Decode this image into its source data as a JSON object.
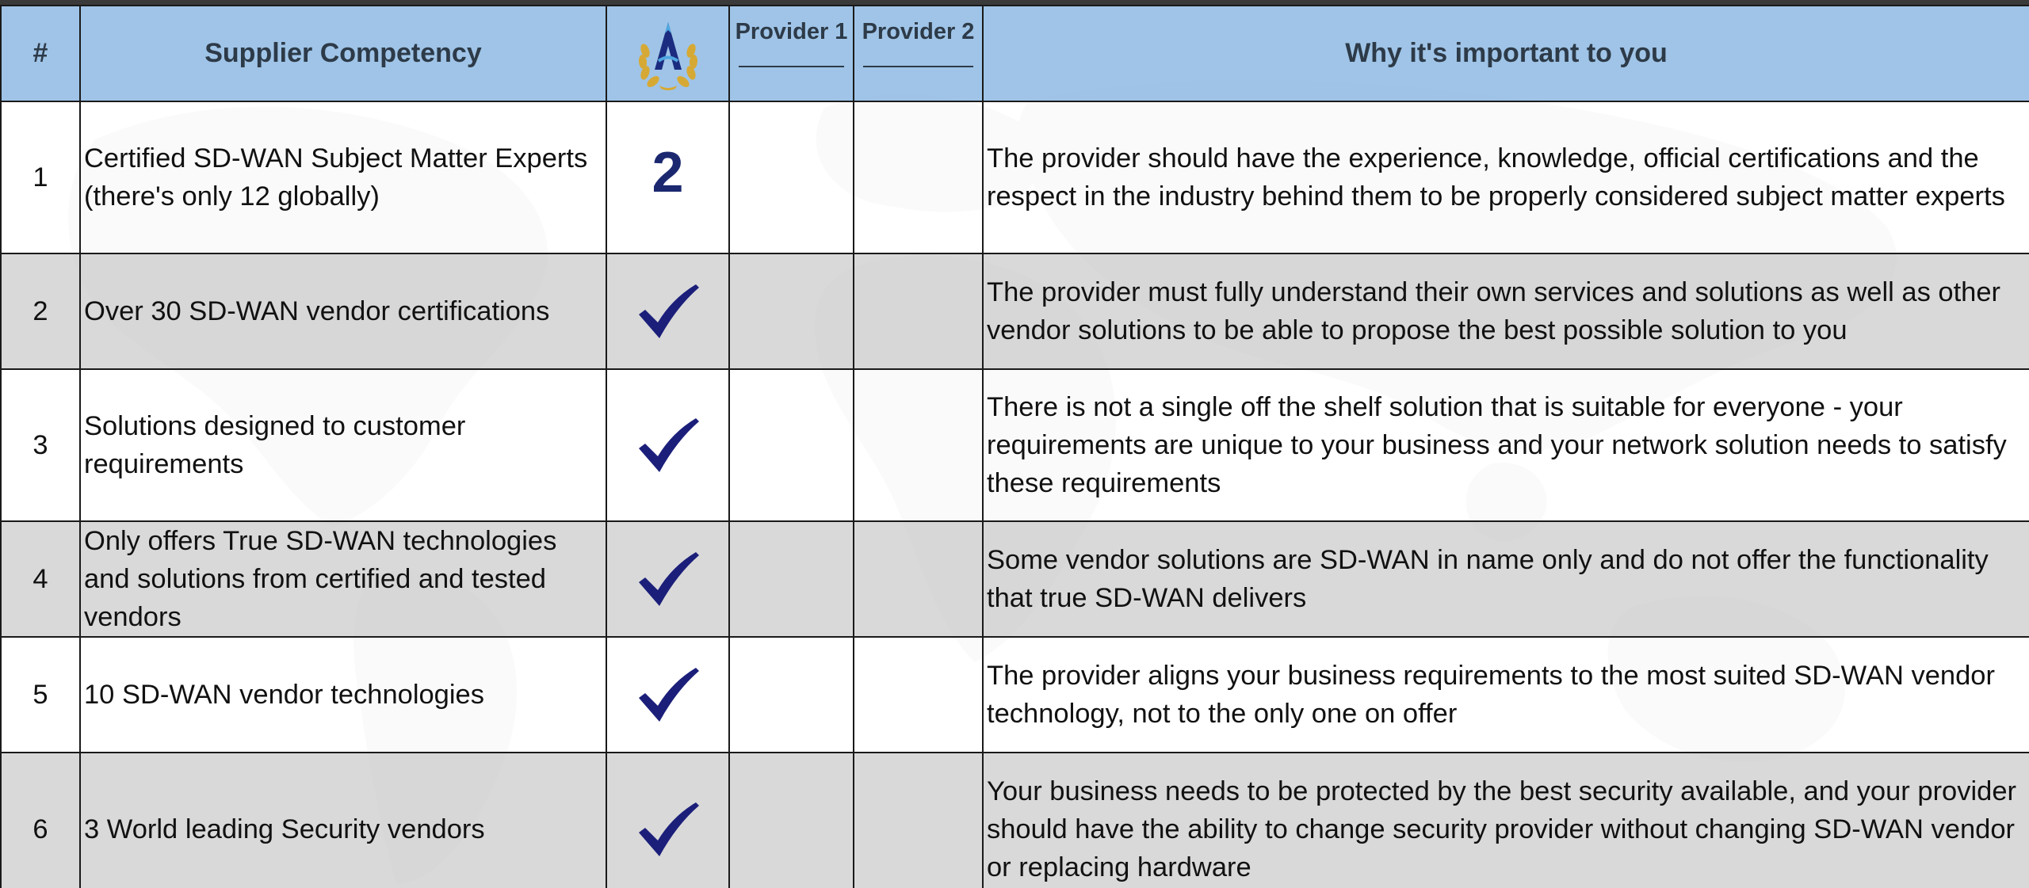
{
  "header": {
    "num_label": "#",
    "competency_label": "Supplier Competency",
    "logo_icon": "laurel-a-logo-icon",
    "provider1_label": "Provider 1",
    "provider2_label": "Provider 2",
    "why_label": "Why it's important to you"
  },
  "colors": {
    "header_bg": "#9bc2e6",
    "row_alt_bg": "#d6d6d6",
    "check_color": "#1b1f7a",
    "number_color": "#1b2870"
  },
  "rows": [
    {
      "num": "1",
      "competency": "Certified SD-WAN Subject Matter Experts (there's only 12 globally)",
      "mark_type": "text",
      "mark_text": "2",
      "why": "The provider should have the experience, knowledge, official certifications and the respect in the industry behind them to be properly considered subject matter experts"
    },
    {
      "num": "2",
      "competency": "Over 30 SD-WAN vendor certifications",
      "mark_type": "check-icon",
      "why": "The provider must fully understand their own services and solutions as well as other vendor solutions to be able to propose the best possible solution to you"
    },
    {
      "num": "3",
      "competency": "Solutions designed to customer requirements",
      "mark_type": "check-icon",
      "why": "There is not a single off the shelf solution that is suitable for everyone - your requirements are unique to your business and your network solution needs to satisfy these requirements"
    },
    {
      "num": "4",
      "competency": "Only offers True SD-WAN technologies and solutions from certified and tested vendors",
      "mark_type": "check-icon",
      "why": "Some vendor solutions are SD-WAN in name only and do not offer the functionality that true SD-WAN delivers"
    },
    {
      "num": "5",
      "competency": "10 SD-WAN vendor technologies",
      "mark_type": "check-icon",
      "why": "The provider aligns your business requirements to the most suited SD-WAN vendor technology, not to the only one on offer"
    },
    {
      "num": "6",
      "competency": "3 World leading Security vendors",
      "mark_type": "check-icon",
      "why": "Your business needs to be protected by the best security available, and your provider should have the ability to change security provider without changing SD-WAN vendor or replacing hardware"
    }
  ]
}
